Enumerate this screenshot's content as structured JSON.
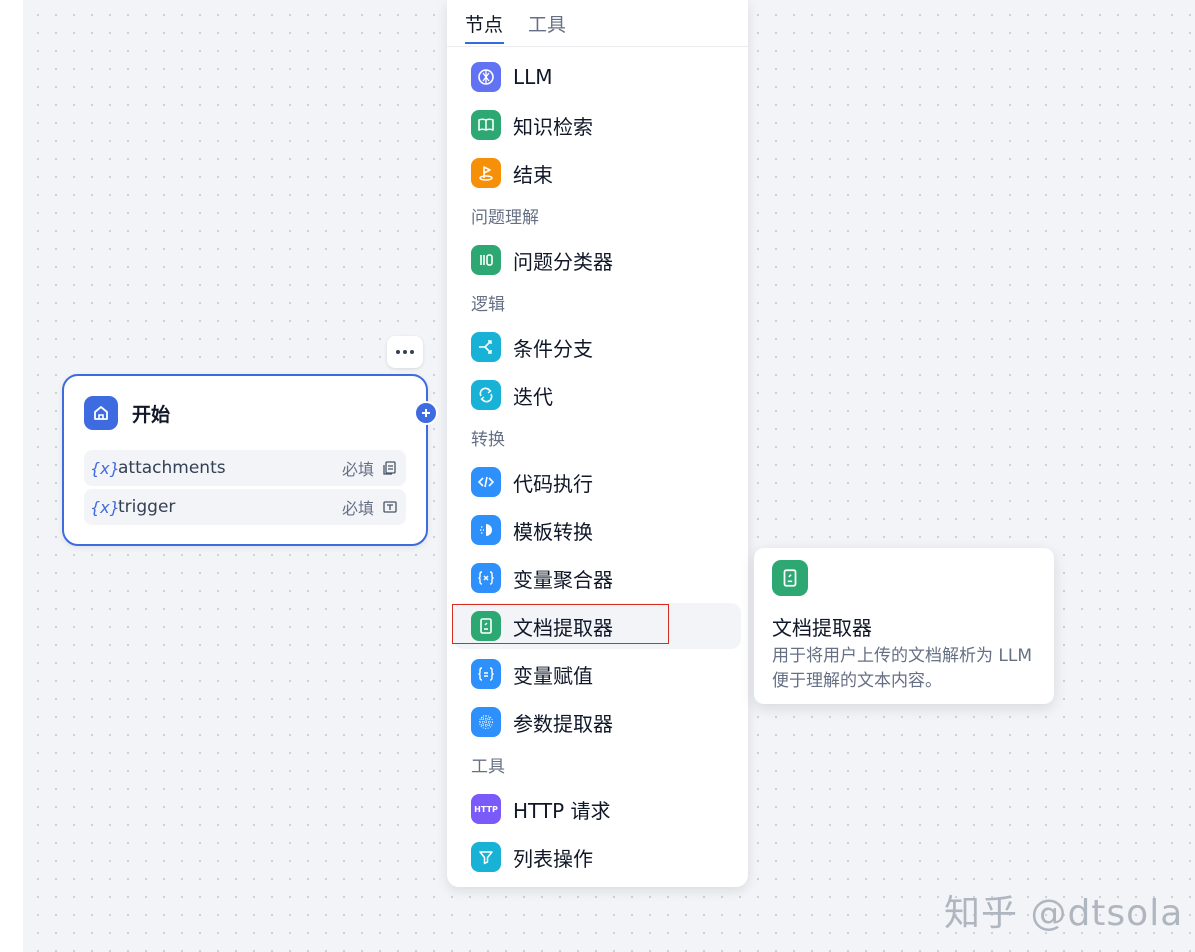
{
  "start_node": {
    "title": "开始",
    "variables": [
      {
        "brace": "{x}",
        "name": "attachments",
        "required": "必填",
        "icon": "file-list-icon"
      },
      {
        "brace": "{x}",
        "name": "trigger",
        "required": "必填",
        "icon": "text-input-icon"
      }
    ]
  },
  "menu": {
    "tabs": [
      {
        "label": "节点",
        "active": true
      },
      {
        "label": "工具",
        "active": false
      }
    ],
    "groups": {
      "question": "问题理解",
      "logic": "逻辑",
      "transform": "转换",
      "tools": "工具"
    },
    "items": {
      "llm": {
        "label": "LLM",
        "icon": "llm-icon",
        "color": "#6172f3"
      },
      "knowledge": {
        "label": "知识检索",
        "icon": "book-icon",
        "color": "#2da872"
      },
      "end": {
        "label": "结束",
        "icon": "end-flag-icon",
        "color": "#f79009"
      },
      "classifier": {
        "label": "问题分类器",
        "icon": "classifier-icon",
        "color": "#2da872"
      },
      "if_else": {
        "label": "条件分支",
        "icon": "branch-icon",
        "color": "#17b2d6"
      },
      "iteration": {
        "label": "迭代",
        "icon": "loop-icon",
        "color": "#17b2d6"
      },
      "code": {
        "label": "代码执行",
        "icon": "code-icon",
        "color": "#2e90fa"
      },
      "template": {
        "label": "模板转换",
        "icon": "template-icon",
        "color": "#2e90fa"
      },
      "aggregator": {
        "label": "变量聚合器",
        "icon": "variable-icon",
        "color": "#2e90fa"
      },
      "doc_extractor": {
        "label": "文档提取器",
        "icon": "document-icon",
        "color": "#2da872"
      },
      "assigner": {
        "label": "变量赋值",
        "icon": "assign-icon",
        "color": "#2e90fa"
      },
      "param_extractor": {
        "label": "参数提取器",
        "icon": "grid-icon",
        "color": "#2e90fa"
      },
      "http": {
        "label": "HTTP 请求",
        "icon": "http-icon",
        "color": "#7a5af8",
        "badge": "HTTP"
      },
      "list_op": {
        "label": "列表操作",
        "icon": "filter-icon",
        "color": "#17b2d6"
      }
    }
  },
  "tooltip": {
    "title": "文档提取器",
    "description": "用于将用户上传的文档解析为 LLM 便于理解的文本内容。"
  },
  "watermark": "知乎 @dtsola"
}
